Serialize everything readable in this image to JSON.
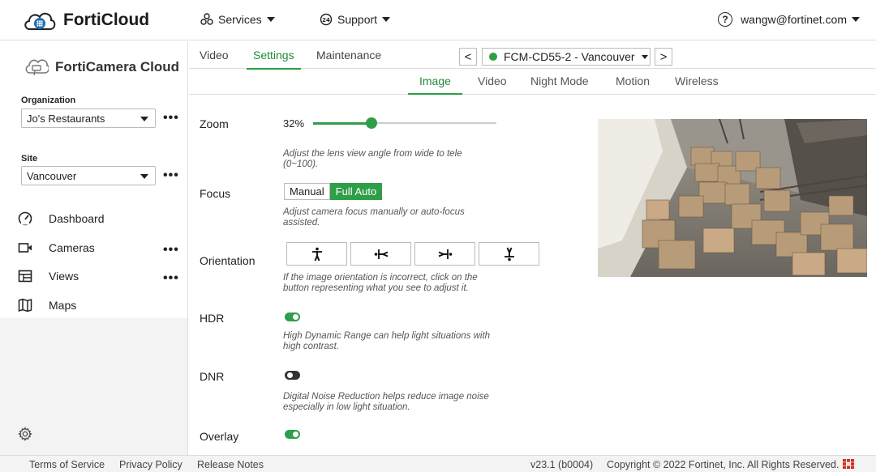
{
  "header": {
    "brand": "FortiCloud",
    "services_label": "Services",
    "support_label": "Support",
    "user_email": "wangw@fortinet.com",
    "help_glyph": "?"
  },
  "sidebar": {
    "app_title": "FortiCamera Cloud",
    "organization_label": "Organization",
    "organization_value": "Jo's Restaurants",
    "site_label": "Site",
    "site_value": "Vancouver",
    "more_glyph": "•••",
    "items": [
      {
        "label": "Dashboard",
        "icon": "dashboard-icon"
      },
      {
        "label": "Cameras",
        "icon": "camera-icon"
      },
      {
        "label": "Views",
        "icon": "views-grid-icon"
      },
      {
        "label": "Maps",
        "icon": "map-icon"
      }
    ]
  },
  "tabs": {
    "primary": [
      "Video",
      "Settings",
      "Maintenance"
    ],
    "primary_active": "Settings",
    "device_name": "FCM-CD55-2 - Vancouver",
    "prev_glyph": "<",
    "next_glyph": ">",
    "secondary": [
      "Image",
      "Video",
      "Night Mode",
      "Motion",
      "Wireless"
    ],
    "secondary_active": "Image"
  },
  "settings": {
    "zoom": {
      "label": "Zoom",
      "value_text": "32%",
      "value": 32,
      "help": "Adjust the lens view angle from wide to tele (0~100)."
    },
    "focus": {
      "label": "Focus",
      "options": [
        "Manual",
        "Full Auto"
      ],
      "selected": "Full Auto",
      "help": "Adjust camera focus manually or auto-focus assisted."
    },
    "orientation": {
      "label": "Orientation",
      "help": "If the image orientation is incorrect, click on the button representing what you see to adjust it."
    },
    "hdr": {
      "label": "HDR",
      "enabled": true,
      "help": "High Dynamic Range can help light situations with high contrast."
    },
    "dnr": {
      "label": "DNR",
      "enabled": false,
      "help": "Digital Noise Reduction helps reduce image noise especially in low light situation."
    },
    "overlay": {
      "label": "Overlay",
      "enabled": true
    }
  },
  "footer": {
    "terms": "Terms of Service",
    "privacy": "Privacy Policy",
    "release_notes": "Release Notes",
    "version": "v23.1 (b0004)",
    "copyright": "Copyright © 2022 Fortinet, Inc. All Rights Reserved."
  },
  "colors": {
    "accent": "#2e9e48",
    "status_online": "#2ea043",
    "fortinet_red": "#da291c"
  }
}
